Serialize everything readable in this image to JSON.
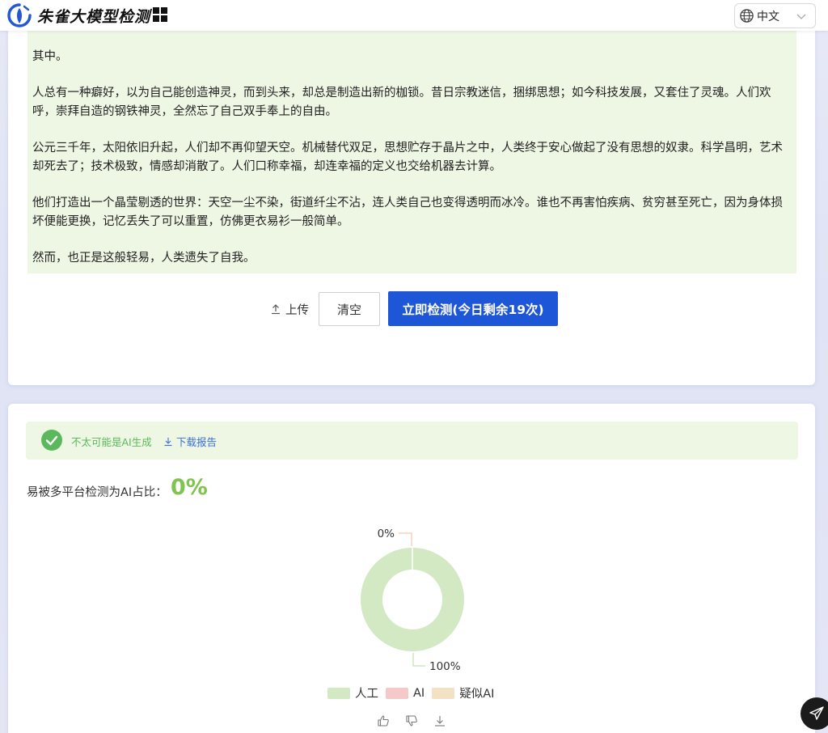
{
  "header": {
    "brand": "朱雀大模型检测",
    "language": "中文",
    "accent_color": "#1e56d8"
  },
  "input": {
    "paragraphs": [
      "其中。",
      "人总有一种癖好，以为自己能创造神灵，而到头来，却总是制造出新的枷锁。昔日宗教迷信，捆绑思想；如今科技发展，又套住了灵魂。人们欢呼，崇拜自造的钢铁神灵，全然忘了自己双手奉上的自由。",
      "公元三千年，太阳依旧升起，人们却不再仰望天空。机械替代双足，思想贮存于晶片之中，人类终于安心做起了没有思想的奴隶。科学昌明，艺术却死去了；技术极致，情感却消散了。人们口称幸福，却连幸福的定义也交给机器去计算。",
      "他们打造出一个晶莹剔透的世界：天空一尘不染，街道纤尘不沾，连人类自己也变得透明而冰冷。谁也不再害怕疾病、贫穷甚至死亡，因为身体损坏便能更换，记忆丢失了可以重置，仿佛更衣易衫一般简单。",
      "然而，也正是这般轻易，人类遗失了自我。"
    ],
    "upload_label": "上传",
    "clear_label": "清空",
    "detect_label": "立即检测(今日剩余19次)"
  },
  "result": {
    "verdict": "不太可能是AI生成",
    "download_label": "下载报告",
    "ratio_label": "易被多平台检测为AI占比：",
    "ratio_value": "0%",
    "status_color": "#5cb85c"
  },
  "chart_data": {
    "type": "pie",
    "donut": true,
    "labels": [
      "人工",
      "AI",
      "疑似AI"
    ],
    "values": [
      100,
      0,
      0
    ],
    "colors": [
      "#d3e9c3",
      "#f6c9c9",
      "#f2e2c3"
    ],
    "data_labels": [
      "100%",
      "0%"
    ],
    "legend": "bottom"
  },
  "feedback": {
    "icons": [
      "thumbs-up-icon",
      "thumbs-down-icon",
      "download-icon"
    ]
  }
}
